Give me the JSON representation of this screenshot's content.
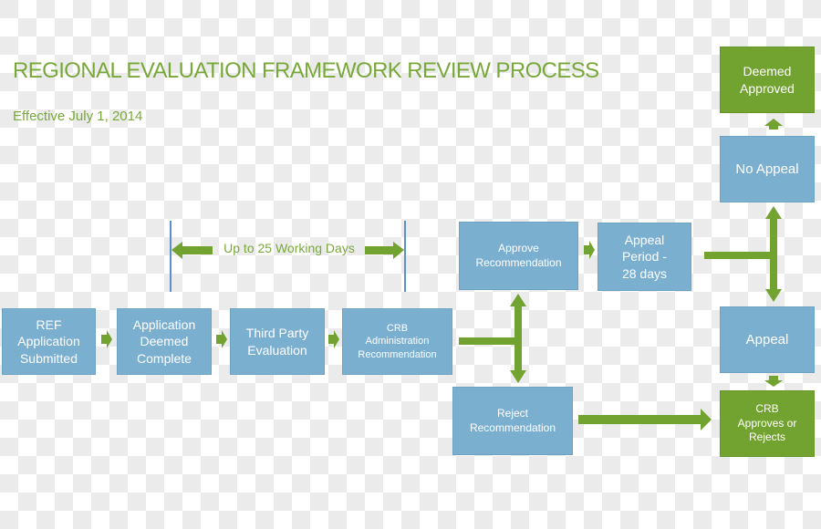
{
  "header": {
    "title": "REGIONAL EVALUATION FRAMEWORK REVIEW PROCESS",
    "subtitle": "Effective July 1, 2014"
  },
  "timespan": {
    "label": "Up to 25 Working Days"
  },
  "colors": {
    "accent_green": "#79a83a",
    "box_blue": "#7bafd0",
    "box_green": "#72a230",
    "marker_blue": "#5b8fcf"
  },
  "steps": {
    "ref_submitted": "REF\nApplication\nSubmitted",
    "deemed_complete": "Application\nDeemed\nComplete",
    "third_party": "Third Party\nEvaluation",
    "crb_admin": "CRB\nAdministration\nRecommendation",
    "approve_rec": "Approve\nRecommendation",
    "appeal_period": "Appeal\nPeriod -\n28 days",
    "reject_rec": "Reject\nRecommendation",
    "no_appeal": "No Appeal",
    "deemed_approved": "Deemed\nApproved",
    "appeal": "Appeal",
    "crb_decides": "CRB\nApproves or\nRejects"
  }
}
